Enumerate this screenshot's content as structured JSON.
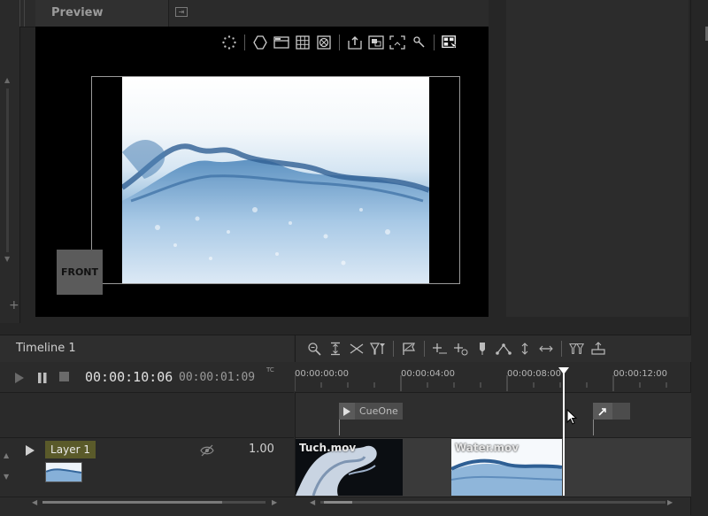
{
  "preview": {
    "title": "Preview",
    "front_label": "FRONT"
  },
  "toolbar_icons": [
    "loading-spinner-icon",
    "hexagon-icon",
    "window-icon",
    "grid-icon",
    "mask-icon",
    "upload-icon",
    "frame-icon",
    "crop-icon",
    "pin-icon",
    "screen-select-icon"
  ],
  "timeline": {
    "title": "Timeline 1",
    "current_timecode": "00:00:10:06",
    "duration_timecode": "00:00:01:09",
    "tc_label": "TC",
    "ruler_ticks": [
      "00:00:00:00",
      "00:00:04:00",
      "00:00:08:00",
      "00:00:12:00"
    ],
    "cue_name": "CueOne",
    "layer_name": "Layer 1",
    "layer_opacity": "1.00",
    "clips": [
      {
        "name": "Tuch.mov"
      },
      {
        "name": "Water.mov"
      }
    ]
  },
  "colors": {
    "layer_name_bg": "#5a5a2a",
    "playhead": "#ffffff"
  }
}
